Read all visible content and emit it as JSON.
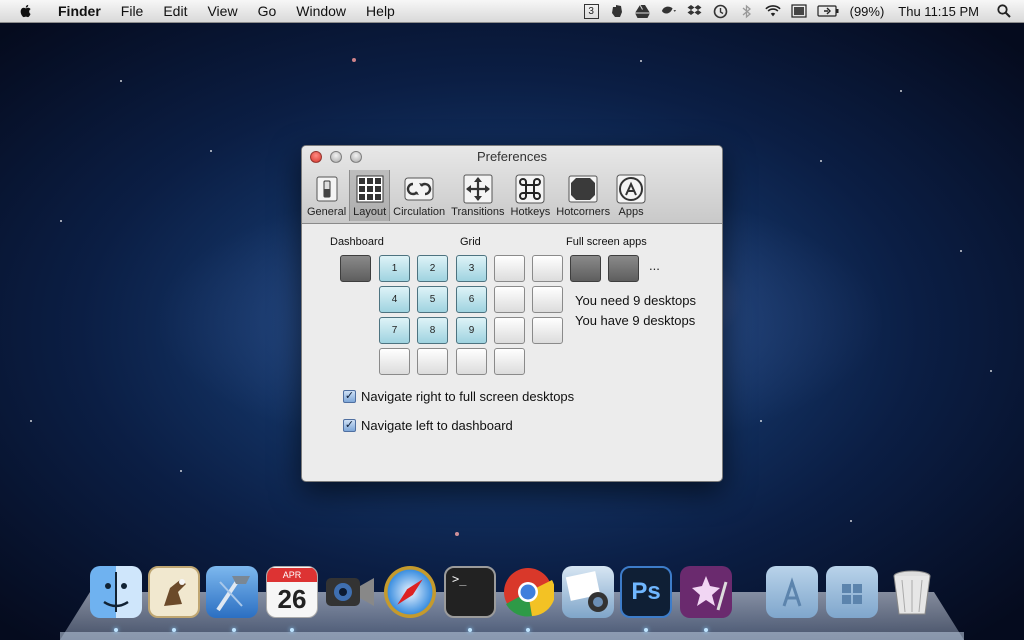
{
  "menubar": {
    "app_name": "Finder",
    "items": [
      "File",
      "Edit",
      "View",
      "Go",
      "Window",
      "Help"
    ],
    "status_icons": [
      "spaces-3-icon",
      "evernote-icon",
      "google-drive-icon",
      "leaf-icon",
      "dropbox-icon",
      "time-machine-icon",
      "bluetooth-icon",
      "wifi-icon",
      "display-icon",
      "battery-icon"
    ],
    "spaces_number": "3",
    "battery": "(99%)",
    "clock": "Thu 11:15 PM"
  },
  "window": {
    "title": "Preferences",
    "tabs": [
      {
        "label": "General",
        "icon": "switch-icon",
        "selected": false
      },
      {
        "label": "Layout",
        "icon": "grid-icon",
        "selected": true
      },
      {
        "label": "Circulation",
        "icon": "loop-icon",
        "selected": false
      },
      {
        "label": "Transitions",
        "icon": "arrows-icon",
        "selected": false
      },
      {
        "label": "Hotkeys",
        "icon": "command-key-icon",
        "selected": false
      },
      {
        "label": "Hotcorners",
        "icon": "hotcorners-icon",
        "selected": false
      },
      {
        "label": "Apps",
        "icon": "app-store-icon",
        "selected": false
      }
    ],
    "layout": {
      "dashboard_label": "Dashboard",
      "grid_label": "Grid",
      "fullscreen_label": "Full screen apps",
      "numbers": [
        "1",
        "2",
        "3",
        "4",
        "5",
        "6",
        "7",
        "8",
        "9"
      ],
      "ellipsis": "...",
      "need_text": "You need 9 desktops",
      "have_text": "You have 9 desktops",
      "nav_right_label": "Navigate right to full screen desktops",
      "nav_right_checked": true,
      "nav_left_label": "Navigate left to dashboard",
      "nav_left_checked": true
    }
  },
  "dock": {
    "apps": [
      "finder-icon",
      "mail-icon",
      "xcode-icon",
      "calendar-icon",
      "facetime-icon",
      "safari-icon",
      "terminal-icon",
      "chrome-icon",
      "iphoto-icon",
      "photoshop-icon",
      "preview-icon",
      "applications-folder-icon",
      "documents-folder-icon",
      "trash-icon"
    ],
    "calendar_month": "APR",
    "calendar_day": "26",
    "photoshop_text": "Ps",
    "terminal_prompt": ">_"
  }
}
